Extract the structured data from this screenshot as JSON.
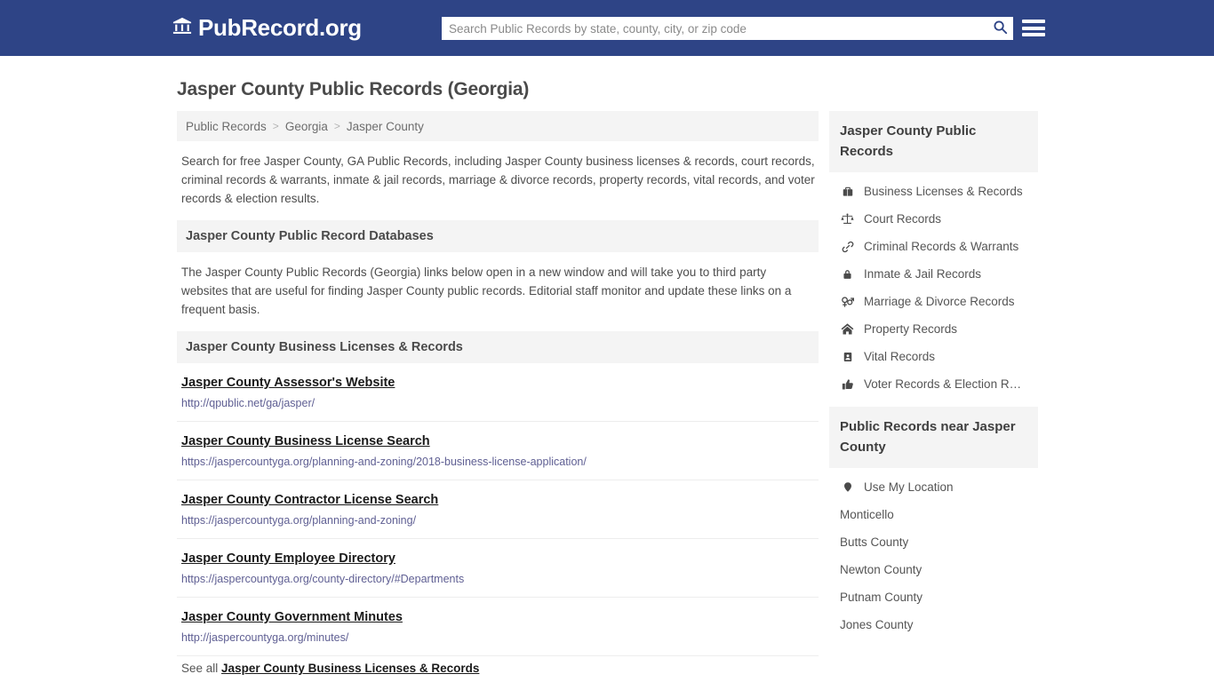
{
  "header": {
    "brand_name": "PubRecord.org",
    "brand_icon": "bank-icon",
    "search_placeholder": "Search Public Records by state, county, city, or zip code",
    "search_value": "",
    "search_icon": "search-icon",
    "menu_icon": "hamburger-menu-icon"
  },
  "page": {
    "title": "Jasper County Public Records (Georgia)"
  },
  "breadcrumb": {
    "items": [
      "Public Records",
      "Georgia",
      "Jasper County"
    ],
    "separator": ">"
  },
  "intro": {
    "summary": "Search for free Jasper County, GA Public Records, including Jasper County business licenses & records, court records, criminal records & warrants, inmate & jail records, marriage & divorce records, property records, vital records, and voter records & election results.",
    "databases_heading": "Jasper County Public Record Databases",
    "databases_text": "The Jasper County Public Records (Georgia) links below open in a new window and will take you to third party websites that are useful for finding Jasper County public records. Editorial staff monitor and update these links on a frequent basis."
  },
  "business_section": {
    "heading": "Jasper County Business Licenses & Records",
    "links": [
      {
        "title": "Jasper County Assessor's Website",
        "url": "http://qpublic.net/ga/jasper/"
      },
      {
        "title": "Jasper County Business License Search",
        "url": "https://jaspercountyga.org/planning-and-zoning/2018-business-license-application/"
      },
      {
        "title": "Jasper County Contractor License Search",
        "url": "https://jaspercountyga.org/planning-and-zoning/"
      },
      {
        "title": "Jasper County Employee Directory",
        "url": "https://jaspercountyga.org/county-directory/#Departments"
      },
      {
        "title": "Jasper County Government Minutes",
        "url": "http://jaspercountyga.org/minutes/"
      }
    ],
    "see_all_prefix": "See all",
    "see_all_link": "Jasper County Business Licenses & Records"
  },
  "sidebar": {
    "records_box": {
      "heading": "Jasper County Public Records",
      "items": [
        {
          "label": "Business Licenses & Records",
          "icon": "briefcase-icon"
        },
        {
          "label": "Court Records",
          "icon": "scales-balance-icon"
        },
        {
          "label": "Criminal Records & Warrants",
          "icon": "chain-link-icon"
        },
        {
          "label": "Inmate & Jail Records",
          "icon": "lock-icon"
        },
        {
          "label": "Marriage & Divorce Records",
          "icon": "venus-mars-icon"
        },
        {
          "label": "Property Records",
          "icon": "home-icon"
        },
        {
          "label": "Vital Records",
          "icon": "id-badge-icon"
        },
        {
          "label": "Voter Records & Election R…",
          "icon": "thumbs-up-icon"
        }
      ]
    },
    "near_box": {
      "heading": "Public Records near Jasper County",
      "items": [
        {
          "label": "Use My Location",
          "icon": "map-pin-icon"
        },
        {
          "label": "Monticello",
          "icon": ""
        },
        {
          "label": "Butts County",
          "icon": ""
        },
        {
          "label": "Newton County",
          "icon": ""
        },
        {
          "label": "Putnam County",
          "icon": ""
        },
        {
          "label": "Jones County",
          "icon": ""
        }
      ]
    }
  },
  "colors": {
    "header_blue": "#2e4486",
    "section_gray": "#f4f4f4",
    "url_link": "#5f5f93",
    "title_text": "#4a4a4a"
  }
}
